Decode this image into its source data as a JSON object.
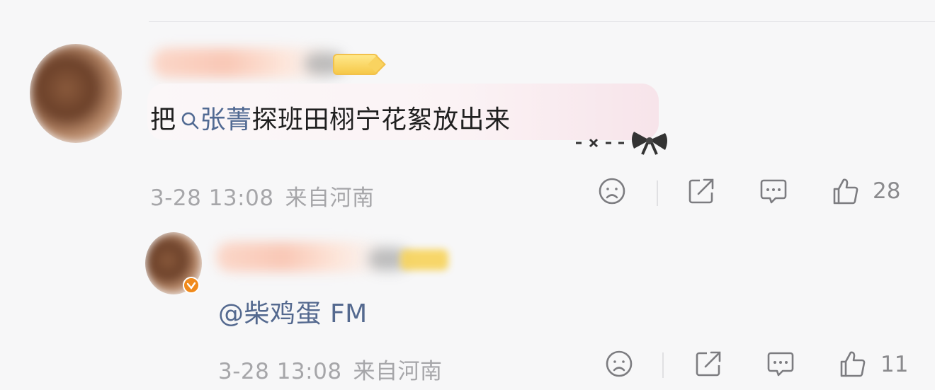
{
  "comment": {
    "content_prefix": "把",
    "mention_search": "张菁",
    "content_suffix": "探班田栩宁花絮放出来",
    "time": "3-28 13:08",
    "location": "来自河南",
    "likes": "28"
  },
  "reply": {
    "content": "@柴鸡蛋 FM",
    "time": "3-28 13:08",
    "location": "来自河南",
    "likes": "11"
  },
  "icons": {
    "dislike": "sad-face-icon",
    "share": "share-icon",
    "comment": "comment-bubble-icon",
    "like": "thumbs-up-icon",
    "search": "search-icon",
    "decoration": "bow-decoration-icon",
    "verified": "verified-badge-icon"
  },
  "colors": {
    "link": "#516a93",
    "meta": "#a6a6a9",
    "icon": "#7c7c80",
    "verified": "#f08a1c"
  }
}
